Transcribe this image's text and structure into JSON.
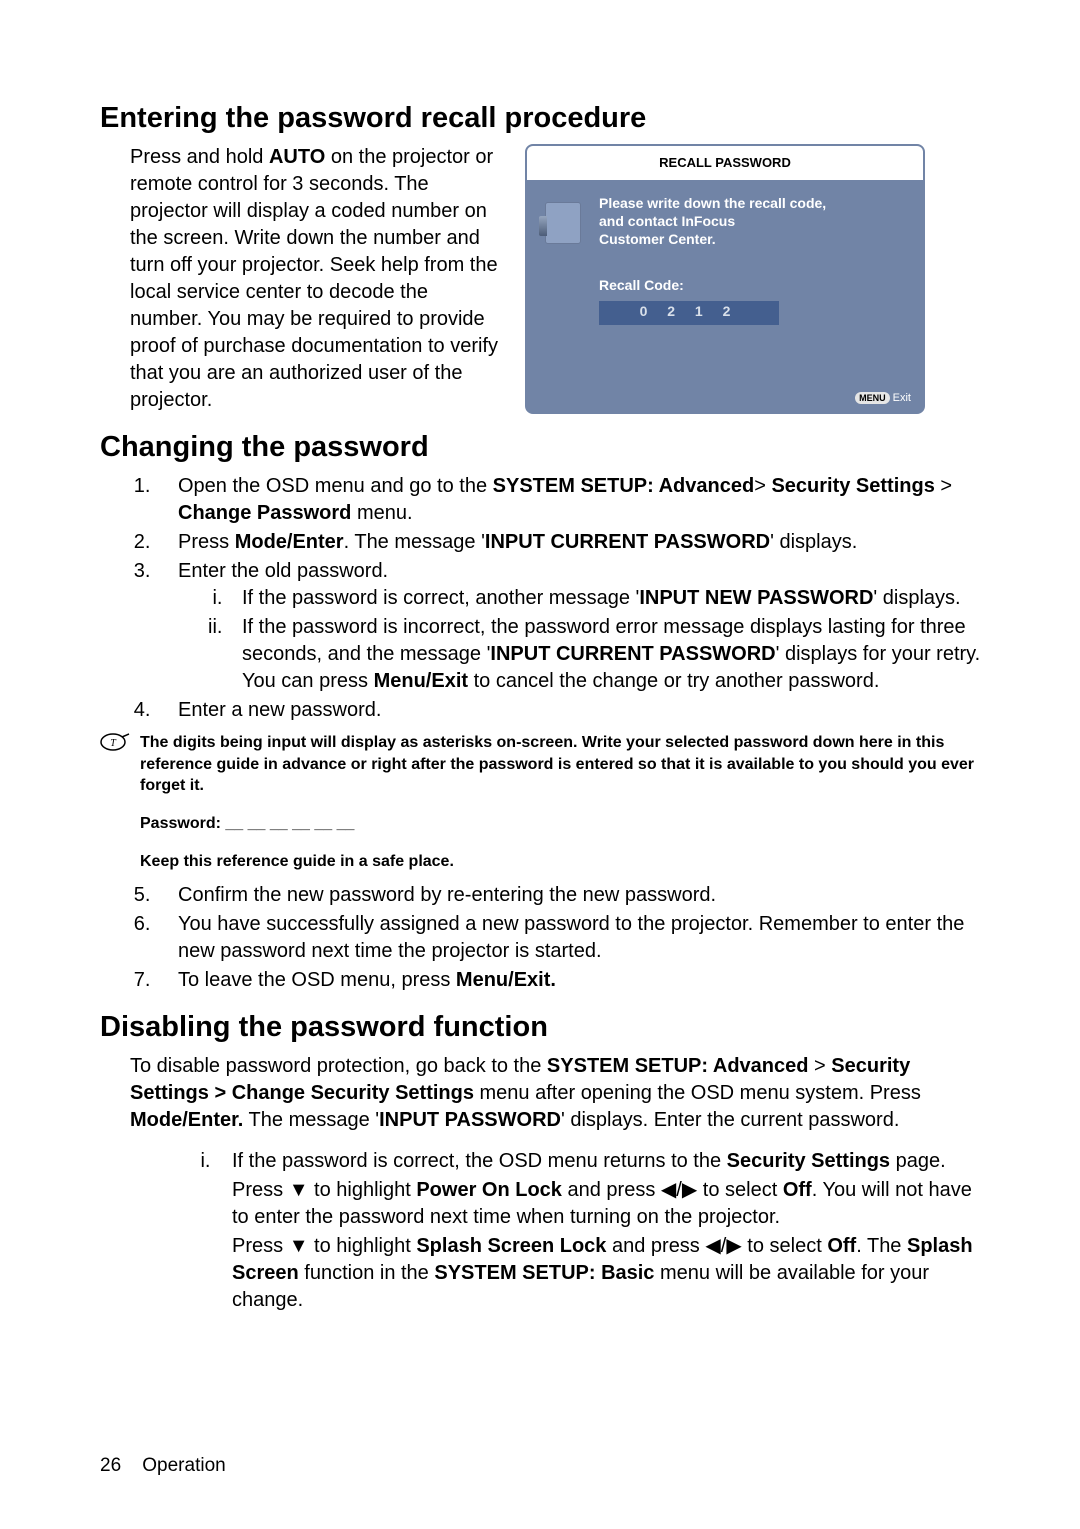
{
  "sections": {
    "recall": {
      "heading": "Entering the password recall procedure",
      "body_1": "Press and hold ",
      "body_auto": "AUTO",
      "body_2": " on the projector or remote control for 3 seconds. The projector will display a coded number on the screen. Write down the number and turn off your projector. Seek help from the local service center to decode the number. You may be required to provide proof of purchase documentation to verify that you are an authorized user of the projector."
    },
    "osd": {
      "title": "RECALL PASSWORD",
      "msg_1": "Please write down the recall code,",
      "msg_2": "and contact InFocus",
      "msg_3": "Customer Center.",
      "recall_label": "Recall Code:",
      "code": "0 2 1 2",
      "menu_btn": "MENU",
      "exit": "Exit"
    },
    "changing": {
      "heading": "Changing the password",
      "li1_a": "Open the OSD menu and go to the ",
      "li1_b": "SYSTEM SETUP: Advanced",
      "li1_c": "> ",
      "li1_d": "Security Settings",
      "li1_e": " > ",
      "li1_f": "Change Password",
      "li1_g": " menu.",
      "li2_a": "Press ",
      "li2_b": "Mode/Enter",
      "li2_c": ". The message '",
      "li2_d": "INPUT CURRENT PASSWORD",
      "li2_e": "' displays.",
      "li3": "Enter the old password.",
      "li3_i_a": "If the password is correct, another message '",
      "li3_i_b": "INPUT NEW PASSWORD",
      "li3_i_c": "' displays.",
      "li3_ii_a": "If the password is incorrect, the password error message displays lasting for three seconds, and the message '",
      "li3_ii_b": "INPUT CURRENT PASSWORD",
      "li3_ii_c": "' displays for your retry. You can press ",
      "li3_ii_d": "Menu/Exit",
      "li3_ii_e": " to cancel the change or try another password.",
      "li4": "Enter a new password.",
      "note": "The digits being input will display as asterisks on-screen. Write your selected password down here in this reference guide in advance or right after the password is entered so that it is available to you should you ever forget it.",
      "password_label": "Password: __ __ __ __ __ __",
      "keep_safe": "Keep this reference guide in a safe place.",
      "li5": "Confirm the new password by re-entering the new password.",
      "li6": "You have successfully assigned a new password to the projector. Remember to enter the new password next time the projector is started.",
      "li7_a": "To leave the OSD menu, press ",
      "li7_b": "Menu/Exit."
    },
    "disabling": {
      "heading": "Disabling the password function",
      "p1_a": "To disable password protection, go back to the ",
      "p1_b": "SYSTEM SETUP: Advanced",
      "p1_c": " > ",
      "p1_d": "Security Settings > Change Security Settings",
      "p1_e": " menu after opening the OSD menu system. Press ",
      "p1_f": "Mode/Enter.",
      "p1_g": " The message '",
      "p1_h": "INPUT PASSWORD",
      "p1_i": "' displays. Enter the current password.",
      "i_a": "If the password is correct, the OSD menu returns to the ",
      "i_b": "Security Settings",
      "i_c": " page.",
      "i2_a": "Press ",
      "i2_down": "▼",
      "i2_b": " to highlight ",
      "i2_c": "Power On Lock",
      "i2_d": " and press ",
      "i2_left": "◀",
      "i2_sep": "/",
      "i2_right": "▶",
      "i2_e": "  to select ",
      "i2_f": "Off",
      "i2_g": ". You will not have to enter the password next time when turning on the projector.",
      "i3_a": "Press ",
      "i3_b": " to highlight ",
      "i3_c": "Splash Screen Lock",
      "i3_d": " and press ",
      "i3_e": "  to select ",
      "i3_f": "Off",
      "i3_g": ". The ",
      "i3_h": "Splash Screen",
      "i3_i": " function in the ",
      "i3_j": "SYSTEM SETUP: Basic",
      "i3_k": " menu will be available for your change."
    }
  },
  "footer": {
    "page": "26",
    "label": "Operation"
  }
}
